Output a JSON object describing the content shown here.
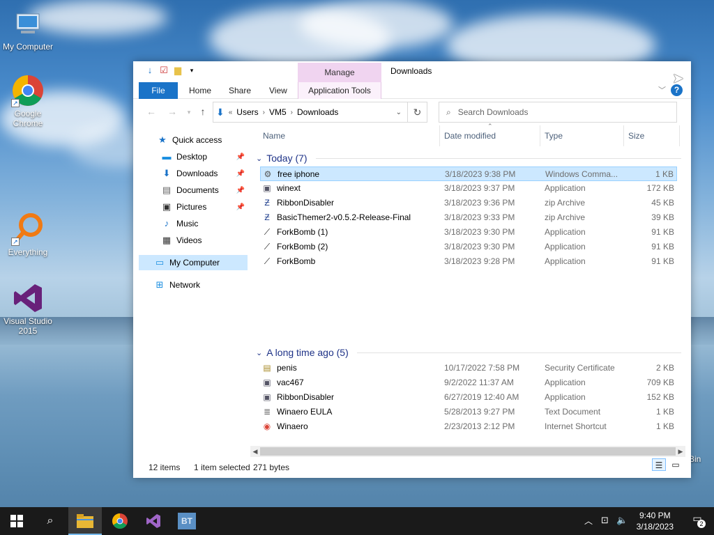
{
  "desktop": {
    "icons": [
      {
        "label": "My Computer",
        "icon": "computer-icon"
      },
      {
        "label": "Google Chrome",
        "icon": "chrome-icon"
      },
      {
        "label": "Everything",
        "icon": "everything-icon"
      },
      {
        "label": "Visual Studio 2015",
        "icon": "visual-studio-icon"
      }
    ],
    "bin_label": "Bin"
  },
  "window": {
    "title": "Downloads",
    "manage_label": "Manage",
    "ribbon_tabs": [
      "File",
      "Home",
      "Share",
      "View",
      "Application Tools"
    ],
    "help_label": "?"
  },
  "address": {
    "crumbs": [
      "Users",
      "VM5",
      "Downloads"
    ],
    "search_placeholder": "Search Downloads"
  },
  "nav": {
    "items": [
      {
        "label": "Quick access",
        "icon": "star-icon",
        "color": "#1a73c8"
      },
      {
        "label": "Desktop",
        "icon": "desktop-folder-icon",
        "color": "#1a8ee0",
        "pinned": true
      },
      {
        "label": "Downloads",
        "icon": "download-arrow-icon",
        "color": "#1a73c8",
        "pinned": true
      },
      {
        "label": "Documents",
        "icon": "document-icon",
        "color": "#666",
        "pinned": true
      },
      {
        "label": "Pictures",
        "icon": "pictures-icon",
        "color": "#333",
        "pinned": true
      },
      {
        "label": "Music",
        "icon": "music-icon",
        "color": "#1a73c8"
      },
      {
        "label": "Videos",
        "icon": "videos-icon",
        "color": "#333"
      },
      {
        "label": "My Computer",
        "icon": "computer-icon",
        "color": "#1a8ee0",
        "selected": true
      },
      {
        "label": "Network",
        "icon": "network-icon",
        "color": "#1a8ee0"
      }
    ]
  },
  "columns": {
    "name": "Name",
    "date": "Date modified",
    "type": "Type",
    "size": "Size"
  },
  "groups": [
    {
      "label": "Today (7)",
      "files": [
        {
          "name": "free iphone",
          "date": "3/18/2023 9:38 PM",
          "type": "Windows Comma...",
          "size": "1 KB",
          "icon": "batch-file-icon",
          "selected": true
        },
        {
          "name": "winext",
          "date": "3/18/2023 9:37 PM",
          "type": "Application",
          "size": "172 KB",
          "icon": "application-icon"
        },
        {
          "name": "RibbonDisabler",
          "date": "3/18/2023 9:36 PM",
          "type": "zip Archive",
          "size": "45 KB",
          "icon": "zip-archive-icon"
        },
        {
          "name": "BasicThemer2-v0.5.2-Release-Final",
          "date": "3/18/2023 9:33 PM",
          "type": "zip Archive",
          "size": "39 KB",
          "icon": "zip-archive-icon"
        },
        {
          "name": "ForkBomb (1)",
          "date": "3/18/2023 9:30 PM",
          "type": "Application",
          "size": "91 KB",
          "icon": "forkbomb-icon"
        },
        {
          "name": "ForkBomb (2)",
          "date": "3/18/2023 9:30 PM",
          "type": "Application",
          "size": "91 KB",
          "icon": "forkbomb-icon"
        },
        {
          "name": "ForkBomb",
          "date": "3/18/2023 9:28 PM",
          "type": "Application",
          "size": "91 KB",
          "icon": "forkbomb-icon"
        }
      ]
    },
    {
      "label": "A long time ago (5)",
      "files": [
        {
          "name": "penis",
          "date": "10/17/2022 7:58 PM",
          "type": "Security Certificate",
          "size": "2 KB",
          "icon": "certificate-icon"
        },
        {
          "name": "vac467",
          "date": "9/2/2022 11:37 AM",
          "type": "Application",
          "size": "709 KB",
          "icon": "application-icon"
        },
        {
          "name": "RibbonDisabler",
          "date": "6/27/2019 12:40 AM",
          "type": "Application",
          "size": "152 KB",
          "icon": "application-icon"
        },
        {
          "name": "Winaero EULA",
          "date": "5/28/2013 9:27 PM",
          "type": "Text Document",
          "size": "1 KB",
          "icon": "text-document-icon"
        },
        {
          "name": "Winaero",
          "date": "2/23/2013 2:12 PM",
          "type": "Internet Shortcut",
          "size": "1 KB",
          "icon": "internet-shortcut-icon"
        }
      ]
    }
  ],
  "status": {
    "items": "12 items",
    "selected": "1 item selected",
    "bytes": "271 bytes"
  },
  "taskbar": {
    "clock_time": "9:40 PM",
    "clock_date": "3/18/2023",
    "notification_count": "2"
  }
}
